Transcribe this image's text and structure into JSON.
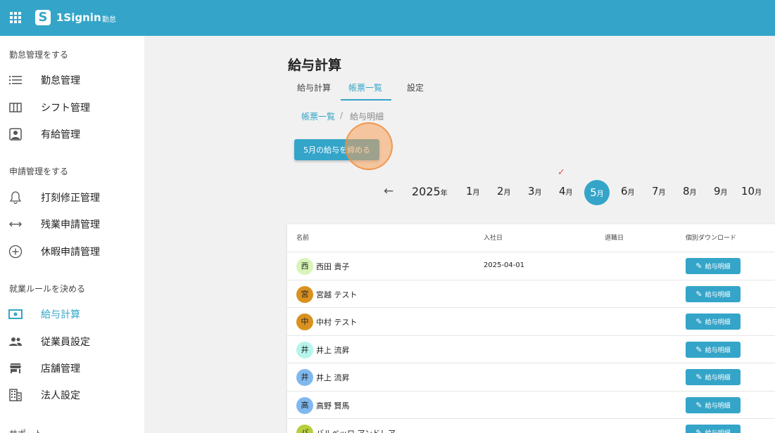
{
  "header": {
    "app_name": "1Signin",
    "app_sub": "勤怠",
    "logo_letter": "S"
  },
  "sidebar": {
    "sections": [
      {
        "label": "勤怠管理をする"
      },
      {
        "label": "申請管理をする"
      },
      {
        "label": "就業ルールを決める"
      },
      {
        "label": "サポート"
      }
    ],
    "items": [
      {
        "label": "勤怠管理",
        "icon": "list-icon"
      },
      {
        "label": "シフト管理",
        "icon": "columns-icon"
      },
      {
        "label": "有給管理",
        "icon": "person-badge-icon"
      },
      {
        "label": "打刻修正管理",
        "icon": "bell-icon"
      },
      {
        "label": "残業申請管理",
        "icon": "arrows-horizontal-icon"
      },
      {
        "label": "休暇申請管理",
        "icon": "plus-circle-icon"
      },
      {
        "label": "給与計算",
        "icon": "money-icon",
        "active": true
      },
      {
        "label": "従業員設定",
        "icon": "people-icon"
      },
      {
        "label": "店舗管理",
        "icon": "store-icon"
      },
      {
        "label": "法人設定",
        "icon": "building-icon"
      }
    ]
  },
  "main": {
    "title": "給与計算",
    "tabs": [
      {
        "label": "給与計算"
      },
      {
        "label": "帳票一覧",
        "active": true
      },
      {
        "label": "設定"
      }
    ],
    "breadcrumb": {
      "parent": "帳票一覧",
      "separator": "/",
      "current": "給与明細"
    },
    "close_button": "5月の給与を締める",
    "year": {
      "number": "2025",
      "suffix": "年"
    },
    "month_suffix": "月",
    "months": [
      "1",
      "2",
      "3",
      "4",
      "5",
      "6",
      "7",
      "8",
      "9",
      "10"
    ],
    "selected_month": "5",
    "checked_month": "4",
    "check_glyph": "✓",
    "prev_arrow": "←"
  },
  "table": {
    "headers": {
      "name": "名前",
      "hire_date": "入社日",
      "leave_date": "退職日",
      "download": "個別ダウンロード"
    },
    "download_label": "給与明細",
    "rows": [
      {
        "initial": "西",
        "name": "西田 貴子",
        "hire_date": "2025-04-01",
        "color": "#d8f5b8"
      },
      {
        "initial": "宮",
        "name": "宮越 テスト",
        "hire_date": "",
        "color": "#d9921f"
      },
      {
        "initial": "中",
        "name": "中村 テスト",
        "hire_date": "",
        "color": "#d9921f"
      },
      {
        "initial": "井",
        "name": "井上 流昇",
        "hire_date": "",
        "color": "#b5f5ec"
      },
      {
        "initial": "井",
        "name": "井上 流昇",
        "hire_date": "",
        "color": "#7fb8ee"
      },
      {
        "initial": "高",
        "name": "高野 賢馬",
        "hire_date": "",
        "color": "#7fb8ee"
      },
      {
        "initial": "バ",
        "name": "バルベッロ アンドレア",
        "hire_date": "",
        "color": "#b5cf3c"
      }
    ]
  },
  "colors": {
    "accent": "#34a5c9",
    "check": "#dd5555",
    "click_indicator": "#f5a05a"
  }
}
